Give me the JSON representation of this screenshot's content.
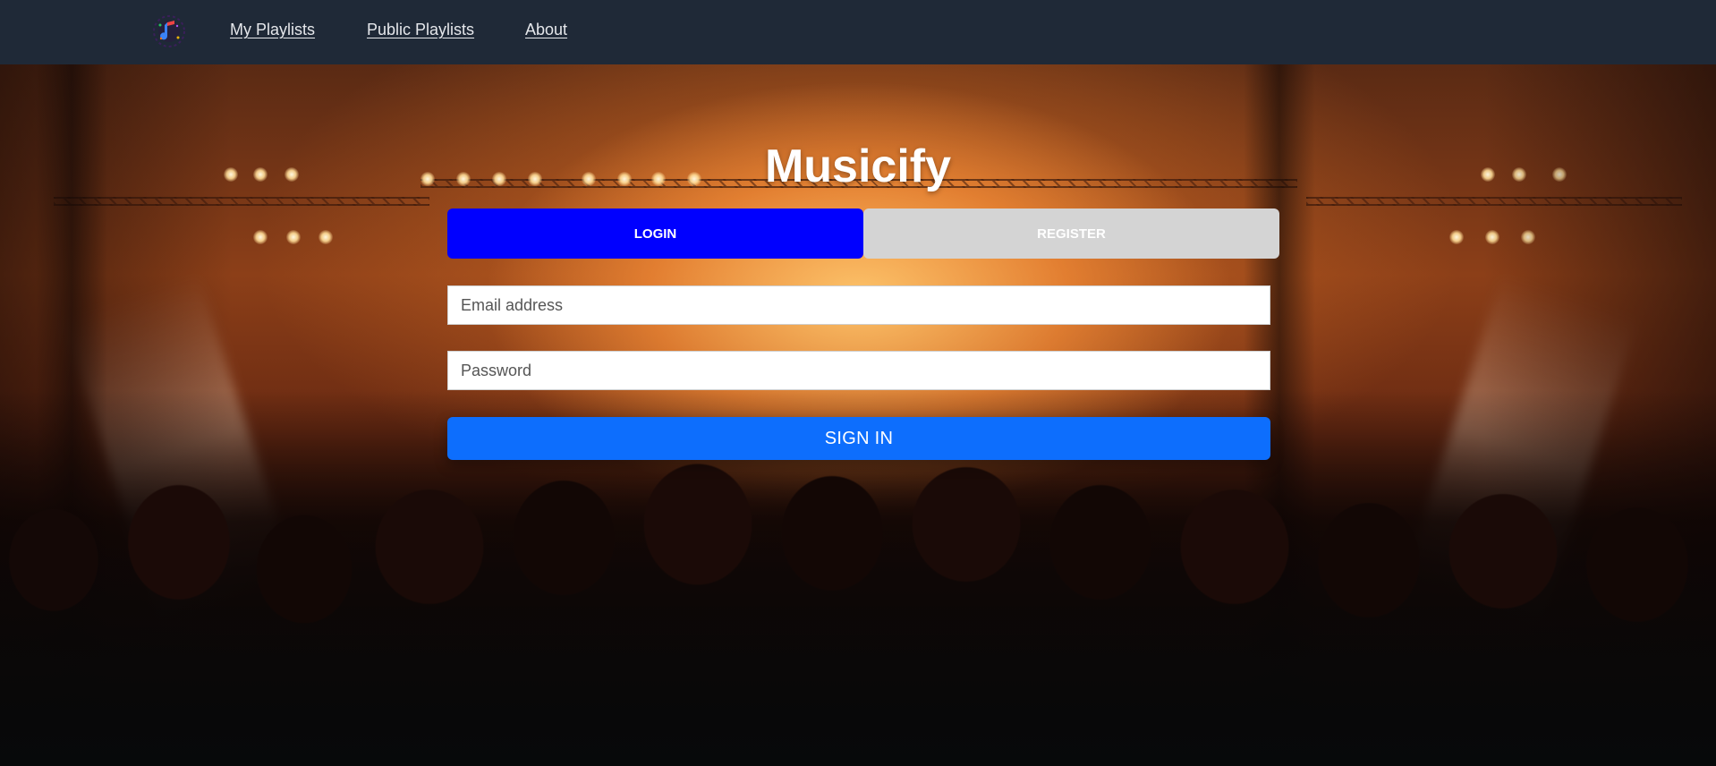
{
  "nav": {
    "links": [
      {
        "label": "My Playlists"
      },
      {
        "label": "Public Playlists"
      },
      {
        "label": "About"
      }
    ]
  },
  "app": {
    "title": "Musicify"
  },
  "auth": {
    "tabs": [
      {
        "label": "LOGIN",
        "active": true
      },
      {
        "label": "REGISTER",
        "active": false
      }
    ],
    "email_placeholder": "Email address",
    "password_placeholder": "Password",
    "submit_label": "SIGN IN"
  },
  "colors": {
    "navbar": "#1f2937",
    "active_tab": "#0000ff",
    "inactive_tab": "#d4d4d4",
    "primary_button": "#0d6efd"
  },
  "icons": {
    "logo": "music-note-logo-icon"
  }
}
